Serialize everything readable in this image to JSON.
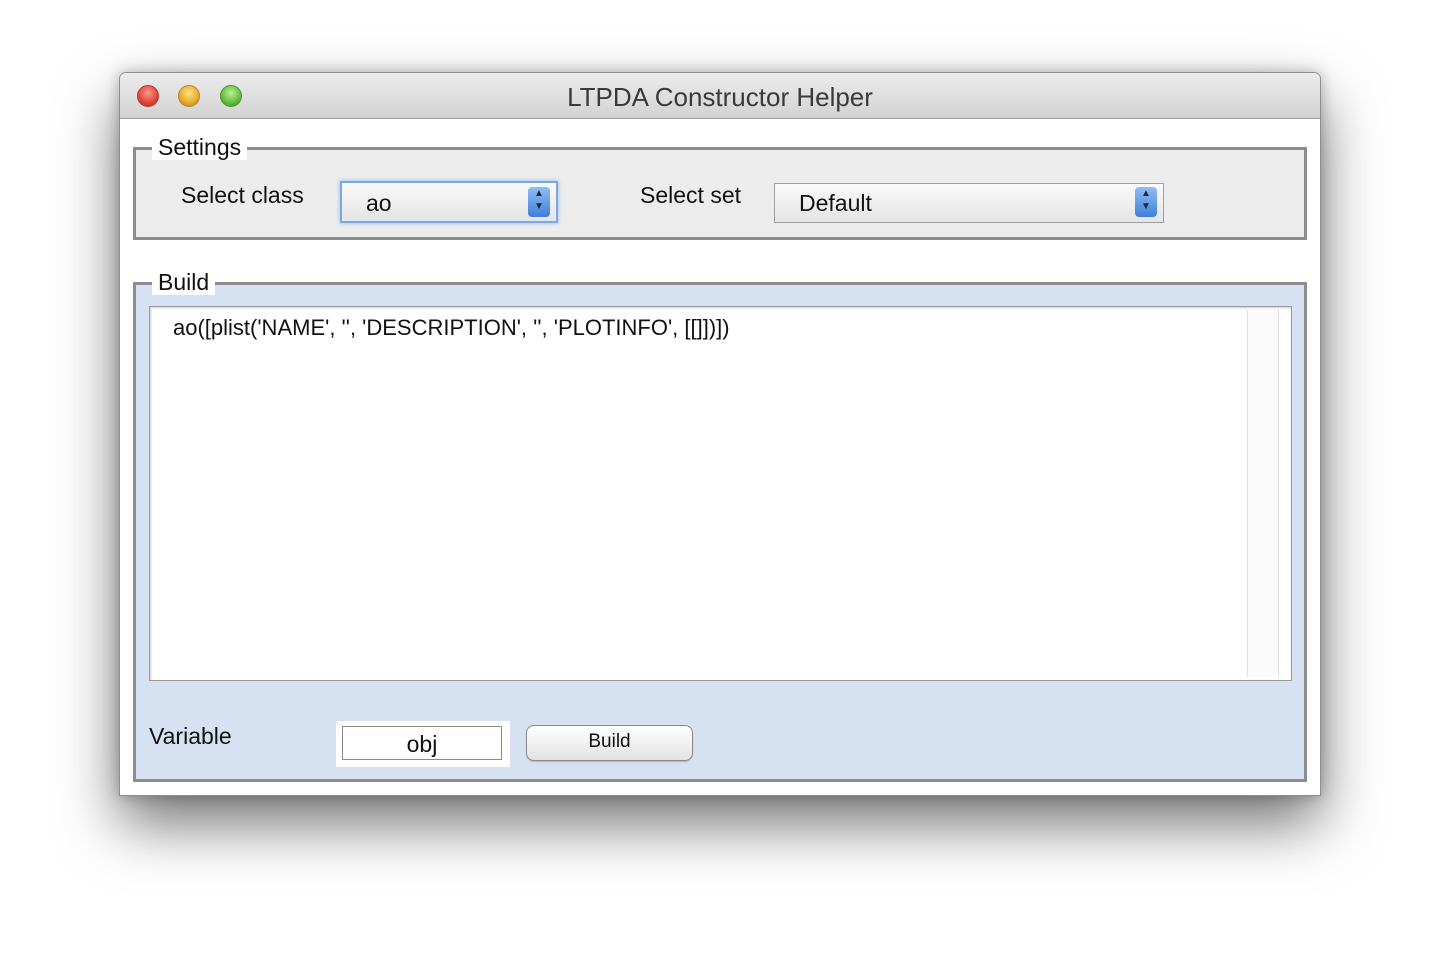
{
  "window": {
    "title": "LTPDA Constructor Helper"
  },
  "settings": {
    "group_label": "Settings",
    "class_label": "Select class",
    "class_value": "ao",
    "set_label": "Select set",
    "set_value": "Default"
  },
  "build": {
    "group_label": "Build",
    "code": "ao([plist('NAME', '', 'DESCRIPTION', '', 'PLOTINFO', [[]])])",
    "variable_label": "Variable",
    "variable_value": "obj",
    "build_button_label": "Build"
  },
  "colors": {
    "build_panel_bg": "#d6e2f2",
    "settings_panel_bg": "#ececec",
    "focus_ring": "#7aa7e6",
    "close_button": "#e0443a",
    "minimize_button": "#e8a92a",
    "zoom_button": "#61bd3c"
  },
  "icons": {
    "close": "close-traffic-light",
    "minimize": "minimize-traffic-light",
    "zoom": "zoom-traffic-light",
    "stepper": "up-down-arrows-icon"
  }
}
